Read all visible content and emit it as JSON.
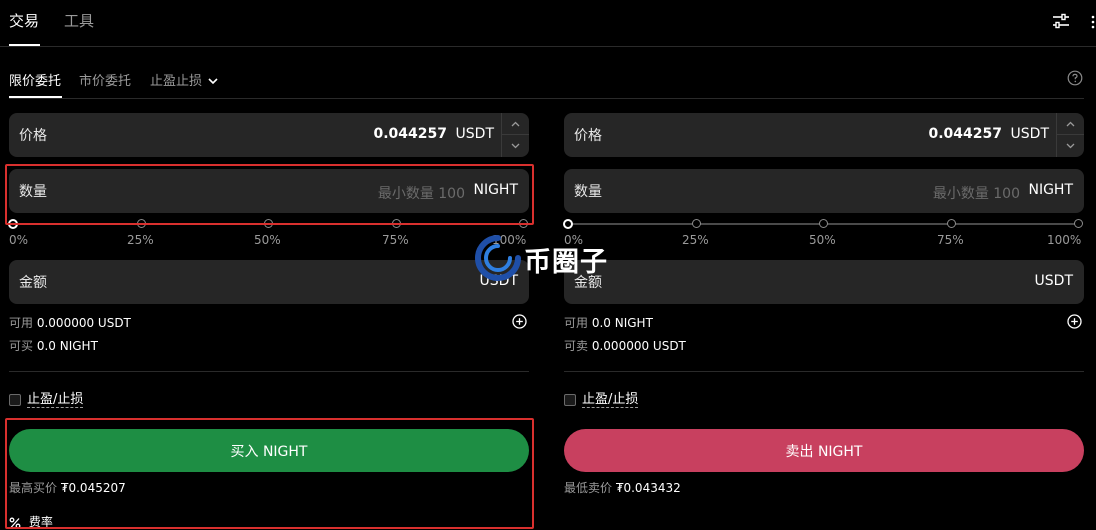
{
  "top_tabs": {
    "trade": "交易",
    "tools": "工具"
  },
  "order_tabs": {
    "limit": "限价委托",
    "market": "市价委托",
    "tpsl": "止盈止损"
  },
  "buy": {
    "price_label": "价格",
    "price_value": "0.044257",
    "price_unit": "USDT",
    "amount_label": "数量",
    "amount_placeholder": "最小数量 100",
    "amount_unit": "NIGHT",
    "slider_labels": [
      "0%",
      "25%",
      "50%",
      "75%",
      "100%"
    ],
    "total_label": "金额",
    "total_unit": "USDT",
    "available_label": "可用",
    "available_value": "0.000000 USDT",
    "can_buy_label": "可买",
    "can_buy_value": "0.0 NIGHT",
    "tpsl_label": "止盈/止损",
    "button_label": "买入 NIGHT",
    "best_price_label": "最高买价",
    "best_price_value": "₮0.045207",
    "fee_label": "费率"
  },
  "sell": {
    "price_label": "价格",
    "price_value": "0.044257",
    "price_unit": "USDT",
    "amount_label": "数量",
    "amount_placeholder": "最小数量 100",
    "amount_unit": "NIGHT",
    "slider_labels": [
      "0%",
      "25%",
      "50%",
      "75%",
      "100%"
    ],
    "total_label": "金额",
    "total_unit": "USDT",
    "available_label": "可用",
    "available_value": "0.0 NIGHT",
    "can_sell_label": "可卖",
    "can_sell_value": "0.000000 USDT",
    "tpsl_label": "止盈/止损",
    "button_label": "卖出 NIGHT",
    "best_price_label": "最低卖价",
    "best_price_value": "₮0.043432"
  },
  "watermark": {
    "text": "币圈子"
  },
  "colors": {
    "background": "#000000",
    "field_bg": "#262626",
    "buy": "#1e8e44",
    "sell": "#c8405f",
    "highlight": "#d9302e"
  }
}
